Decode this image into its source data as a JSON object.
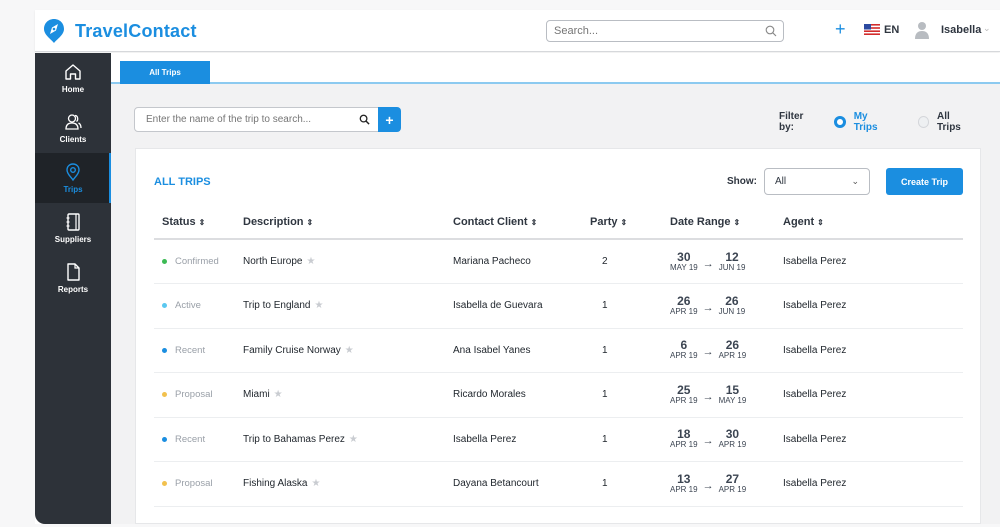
{
  "app": {
    "brand": "TravelContact",
    "brand_color": "#1b8ee0"
  },
  "topbar": {
    "search_placeholder": "Search...",
    "add_icon": "plus-icon",
    "language": "EN",
    "user_name": "Isabella"
  },
  "sidebar": {
    "items": [
      {
        "label": "Home",
        "icon": "home-icon",
        "active": false
      },
      {
        "label": "Clients",
        "icon": "clients-icon",
        "active": false
      },
      {
        "label": "Trips",
        "icon": "map-pin-icon",
        "active": true
      },
      {
        "label": "Suppliers",
        "icon": "notebook-icon",
        "active": false
      },
      {
        "label": "Reports",
        "icon": "document-icon",
        "active": false
      }
    ]
  },
  "tabs": [
    {
      "label": "All Trips",
      "active": true
    }
  ],
  "trip_search": {
    "placeholder": "Enter the name of the trip to search...",
    "add_label": "+"
  },
  "filter": {
    "label": "Filter by:",
    "options": [
      {
        "label": "My Trips",
        "selected": true
      },
      {
        "label": "All Trips",
        "selected": false
      }
    ]
  },
  "card": {
    "title": "ALL TRIPS",
    "show_label": "Show:",
    "show_value": "All",
    "create_label": "Create Trip"
  },
  "table": {
    "columns": [
      "Status",
      "Description",
      "Contact Client",
      "Party",
      "Date Range",
      "Agent"
    ],
    "sort_icon": "⇕",
    "status_colors": {
      "Confirmed": "#3cba54",
      "Active": "#5bc8f0",
      "Recent": "#1b8ee0",
      "Proposal": "#f2c14e"
    },
    "rows": [
      {
        "status": "Confirmed",
        "description": "North Europe",
        "client": "Mariana Pacheco",
        "party": "2",
        "start_day": "30",
        "start_mon": "MAY 19",
        "end_day": "12",
        "end_mon": "JUN 19",
        "agent": "Isabella Perez"
      },
      {
        "status": "Active",
        "description": "Trip to England",
        "client": "Isabella de Guevara",
        "party": "1",
        "start_day": "26",
        "start_mon": "APR 19",
        "end_day": "26",
        "end_mon": "JUN 19",
        "agent": "Isabella Perez"
      },
      {
        "status": "Recent",
        "description": "Family Cruise Norway",
        "client": "Ana Isabel Yanes",
        "party": "1",
        "start_day": "6",
        "start_mon": "APR 19",
        "end_day": "26",
        "end_mon": "APR 19",
        "agent": "Isabella Perez"
      },
      {
        "status": "Proposal",
        "description": "Miami",
        "client": "Ricardo Morales",
        "party": "1",
        "start_day": "25",
        "start_mon": "APR 19",
        "end_day": "15",
        "end_mon": "MAY 19",
        "agent": "Isabella Perez"
      },
      {
        "status": "Recent",
        "description": "Trip to Bahamas Perez",
        "client": "Isabella Perez",
        "party": "1",
        "start_day": "18",
        "start_mon": "APR 19",
        "end_day": "30",
        "end_mon": "APR 19",
        "agent": "Isabella Perez"
      },
      {
        "status": "Proposal",
        "description": "Fishing Alaska",
        "client": "Dayana Betancourt",
        "party": "1",
        "start_day": "13",
        "start_mon": "APR 19",
        "end_day": "27",
        "end_mon": "APR 19",
        "agent": "Isabella Perez"
      }
    ]
  }
}
